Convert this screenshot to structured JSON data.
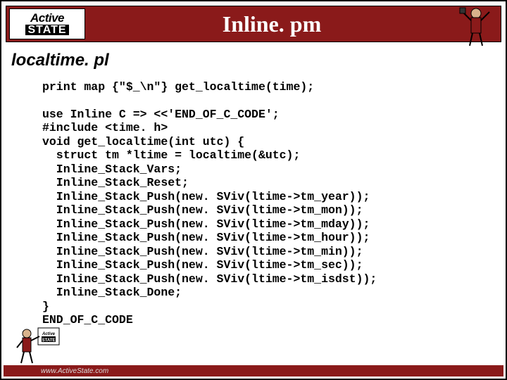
{
  "header": {
    "logo_top": "Active",
    "logo_bottom": "STATE",
    "title": "Inline. pm"
  },
  "subtitle": "localtime. pl",
  "code": "print map {\"$_\\n\"} get_localtime(time);\n\nuse Inline C => <<'END_OF_C_CODE';\n#include <time. h>\nvoid get_localtime(int utc) {\n  struct tm *ltime = localtime(&utc);\n  Inline_Stack_Vars;\n  Inline_Stack_Reset;\n  Inline_Stack_Push(new. SViv(ltime->tm_year));\n  Inline_Stack_Push(new. SViv(ltime->tm_mon));\n  Inline_Stack_Push(new. SViv(ltime->tm_mday));\n  Inline_Stack_Push(new. SViv(ltime->tm_hour));\n  Inline_Stack_Push(new. SViv(ltime->tm_min));\n  Inline_Stack_Push(new. SViv(ltime->tm_sec));\n  Inline_Stack_Push(new. SViv(ltime->tm_isdst));\n  Inline_Stack_Done;\n}\nEND_OF_C_CODE",
  "footer": {
    "url": "www.ActiveState.com"
  }
}
